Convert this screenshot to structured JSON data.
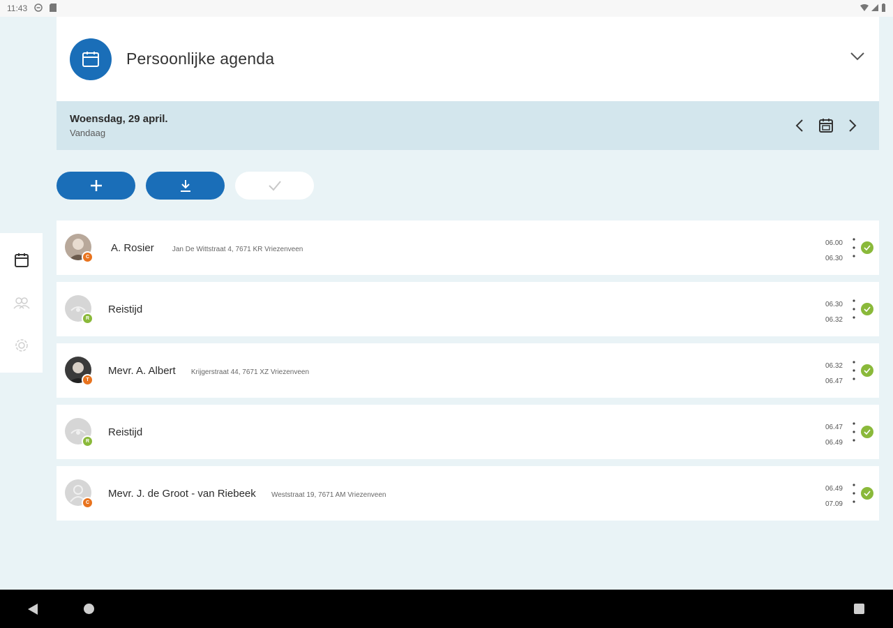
{
  "status_bar": {
    "time": "11:43"
  },
  "header": {
    "title": "Persoonlijke agenda",
    "icon": "calendar-icon"
  },
  "date_bar": {
    "date": "Woensdag, 29 april.",
    "relative": "Vandaag"
  },
  "appointments": [
    {
      "name": "A. Rosier",
      "address": "Jan De Wittstraat 4, 7671 KR Vriezenveen",
      "start": "06.00",
      "end": "06.30",
      "badge": "C",
      "badge_color": "orange",
      "avatar": "photo"
    },
    {
      "name": "Reistijd",
      "address": "",
      "start": "06.30",
      "end": "06.32",
      "badge": "R",
      "badge_color": "green",
      "avatar": "travel"
    },
    {
      "name": "Mevr. A. Albert",
      "address": "Krijgerstraat 44, 7671 XZ Vriezenveen",
      "start": "06.32",
      "end": "06.47",
      "badge": "T",
      "badge_color": "orange",
      "avatar": "photo"
    },
    {
      "name": "Reistijd",
      "address": "",
      "start": "06.47",
      "end": "06.49",
      "badge": "R",
      "badge_color": "green",
      "avatar": "travel"
    },
    {
      "name": "Mevr. J. de Groot - van Riebeek",
      "address": "Weststraat 19, 7671 AM Vriezenveen",
      "start": "06.49",
      "end": "07.09",
      "badge": "C",
      "badge_color": "orange",
      "avatar": "person"
    }
  ],
  "colors": {
    "primary": "#1a6eb8",
    "accent_orange": "#e8731e",
    "done_green": "#8ab93a",
    "background": "#e9f3f6"
  }
}
